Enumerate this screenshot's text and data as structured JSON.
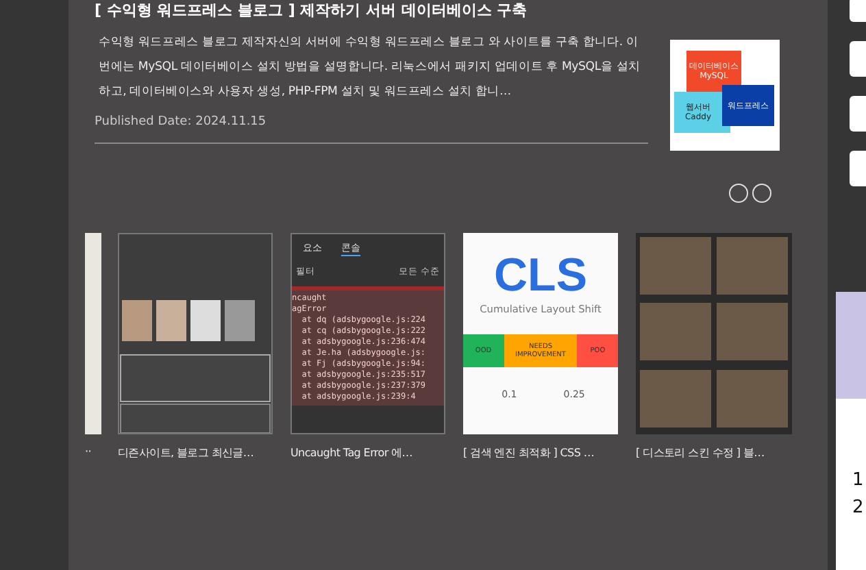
{
  "post": {
    "title": "[ 수익형 워드프레스 블로그 ] 제작하기 서버 데이터베이스 구축",
    "summary": "수익형 워드프레스 블로그 제작자신의 서버에 수익형 워드프레스 블로그 와 사이트를 구축 합니다. 이번에는 MySQL 데이터베이스 설치 방법을 설명합니다. 리눅스에서 패키지 업데이트 후 MySQL을 설치하고, 데이터베이스와 사용자 생성, PHP-FPM 설치 및 워드프레스 설치 합니…",
    "published": "Published Date: 2024.11.15",
    "thumbnail": {
      "boxes": [
        {
          "label": "데이터베이스 MySQL",
          "color": "#f04a2a"
        },
        {
          "label": "웹서버 Caddy",
          "color": "#5bd0e6"
        },
        {
          "label": "워드프레스",
          "color": "#0b3fa8"
        }
      ]
    }
  },
  "related": [
    {
      "kind": "partial",
      "caption": "··"
    },
    {
      "kind": "blog",
      "caption": "디즌사이트, 블로그 최신글…"
    },
    {
      "kind": "console",
      "caption": "Uncaught Tag Error 에…",
      "tabs": [
        "요소",
        "콘솔"
      ],
      "filter": "필터",
      "level": "모든 수준",
      "lines": [
        "ncaught",
        "agError",
        "  at dq (adsbygoogle.js:224",
        "  at cq (adsbygoogle.js:222",
        "  at adsbygoogle.js:236:474",
        "  at Je.ha (adsbygoogle.js:",
        "  at Fj (adsbygoogle.js:94:",
        "  at adsbygoogle.js:235:517",
        "  at adsbygoogle.js:237:379",
        "  at adsbygoogle.js:239:4"
      ]
    },
    {
      "kind": "cls",
      "caption": "[ 검색 엔진 최적화 ] CSS …",
      "big": "CLS",
      "sub": "Cumulative Layout Shift",
      "segments": [
        "OOD",
        "NEEDS IMPROVEMENT",
        "POO"
      ],
      "ticks": [
        "0.1",
        "0.25"
      ]
    },
    {
      "kind": "video",
      "caption": "[ 디스토리 스킨 수정 ] 블…"
    }
  ],
  "side_card": {
    "lines": [
      "1",
      "2"
    ]
  }
}
